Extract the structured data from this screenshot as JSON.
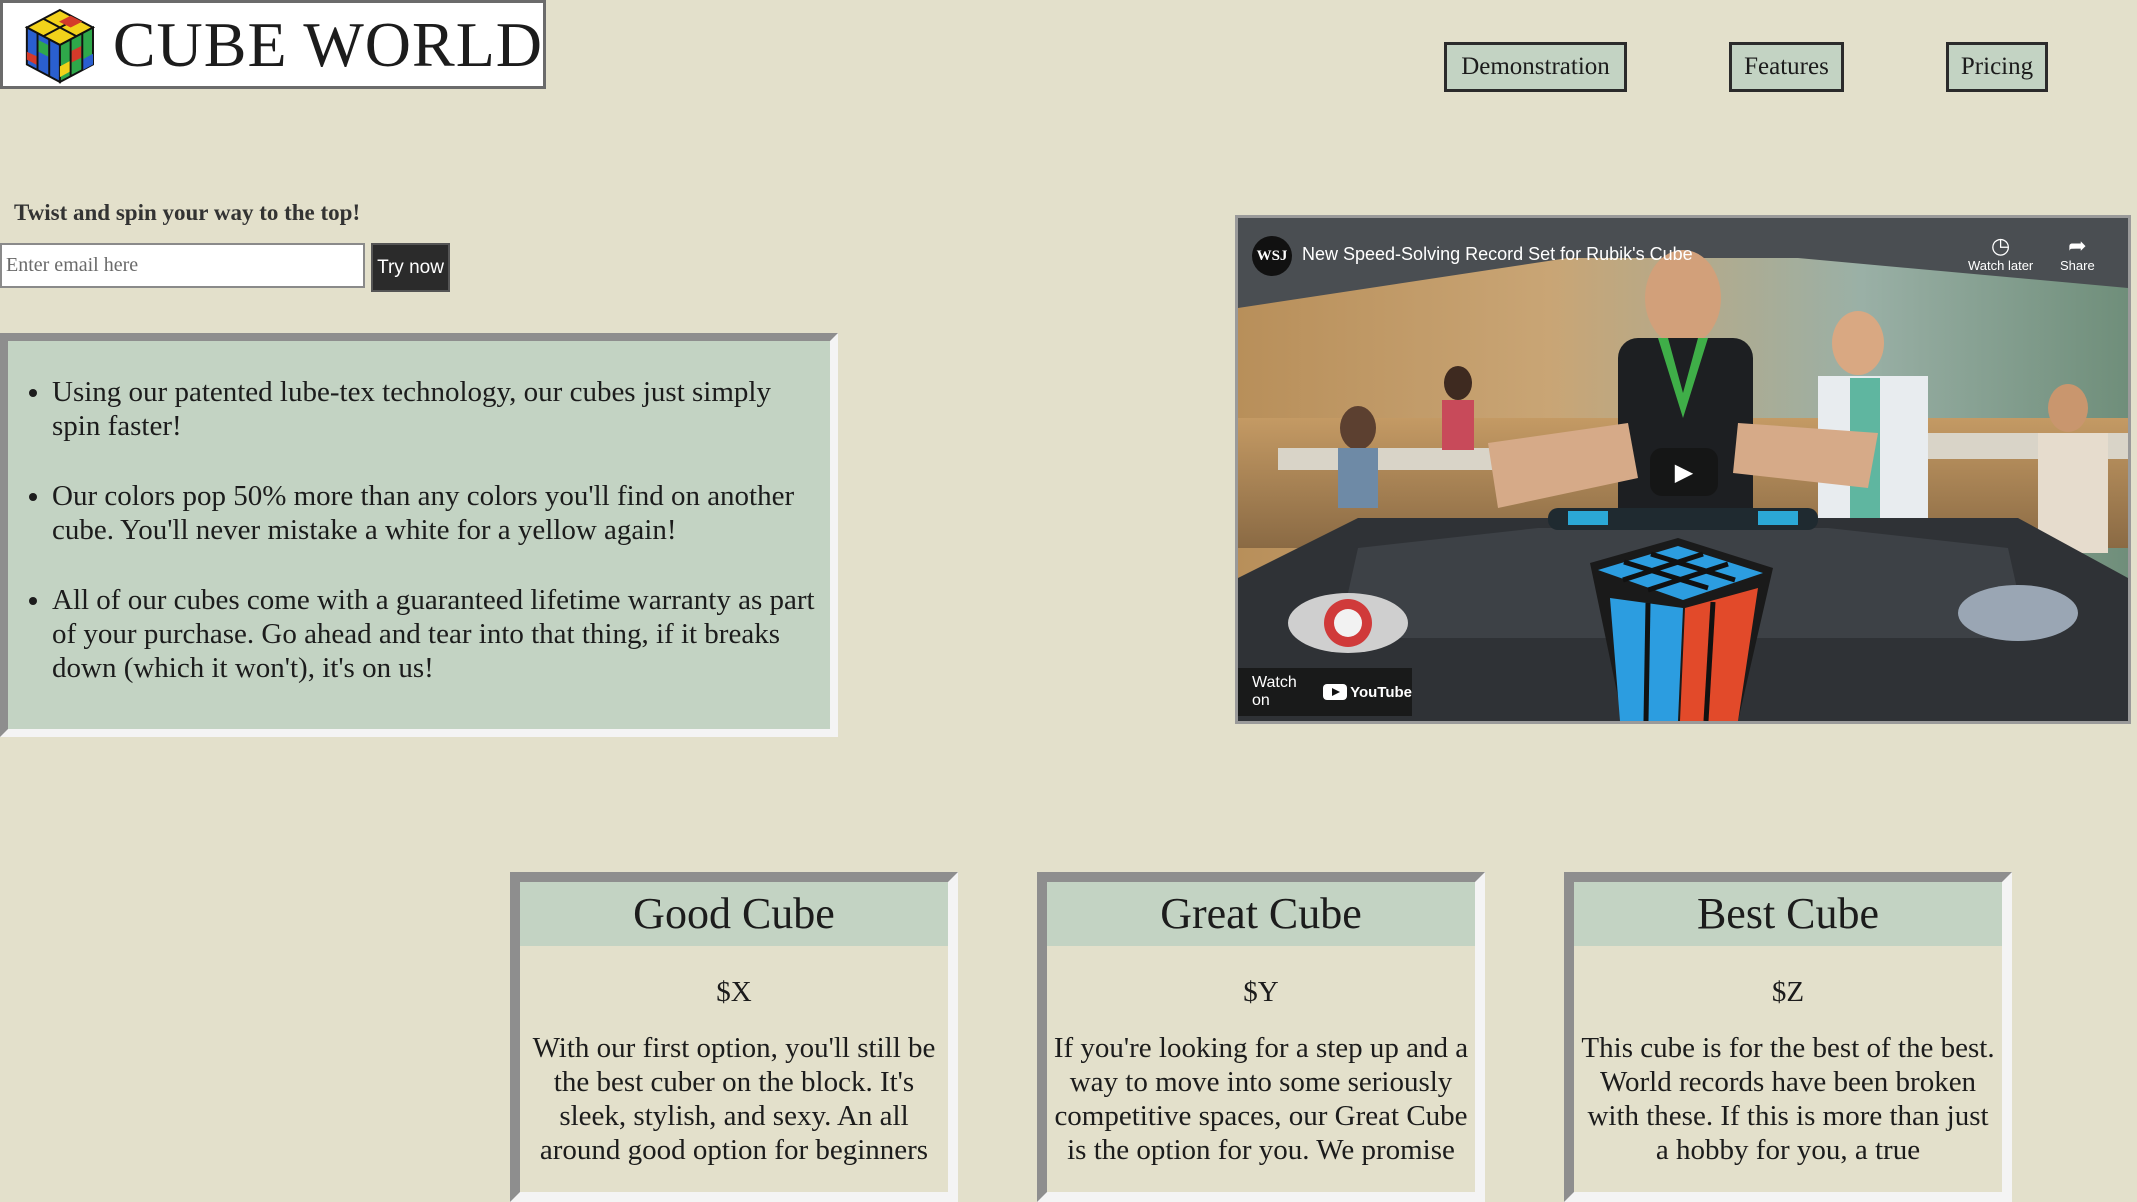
{
  "header": {
    "logo_text": "CUBE WORLD",
    "logo_icon": "rubiks-cube-icon",
    "menu_icon": "hamburger-menu-icon"
  },
  "nav": {
    "items": [
      {
        "label": "Demonstration"
      },
      {
        "label": "Features"
      },
      {
        "label": "Pricing"
      }
    ]
  },
  "signup": {
    "tagline": "Twist and spin your way to the top!",
    "email_placeholder": "Enter email here",
    "button_label": "Try now"
  },
  "features": {
    "items": [
      "Using our patented lube-tex technology, our cubes just simply spin faster!",
      "Our colors pop 50% more than any colors you'll find on another cube. You'll never mistake a white for a yellow again!",
      "All of our cubes come with a guaranteed lifetime warranty as part of your purchase. Go ahead and tear into that thing, if it breaks down (which it won't), it's on us!"
    ]
  },
  "video": {
    "channel_badge": "WSJ",
    "title": "New Speed-Solving Record Set for Rubik's Cube",
    "watch_later": "Watch later",
    "share": "Share",
    "watch_on": "Watch on",
    "youtube": "YouTube"
  },
  "pricing": {
    "cards": [
      {
        "name": "Good Cube",
        "price": "$X",
        "description": "With our first option, you'll still be the best cuber on the block. It's sleek, stylish, and sexy. An all around good option for beginners"
      },
      {
        "name": "Great Cube",
        "price": "$Y",
        "description": "If you're looking for a step up and a way to move into some seriously competitive spaces, our Great Cube is the option for you. We promise"
      },
      {
        "name": "Best Cube",
        "price": "$Z",
        "description": "This cube is for the best of the best. World records have been broken with these. If this is more than just a hobby for you, a true"
      }
    ]
  },
  "colors": {
    "background": "#e3e0cb",
    "accent": "#c3d3c3",
    "button_dark": "#2b2b2b"
  }
}
